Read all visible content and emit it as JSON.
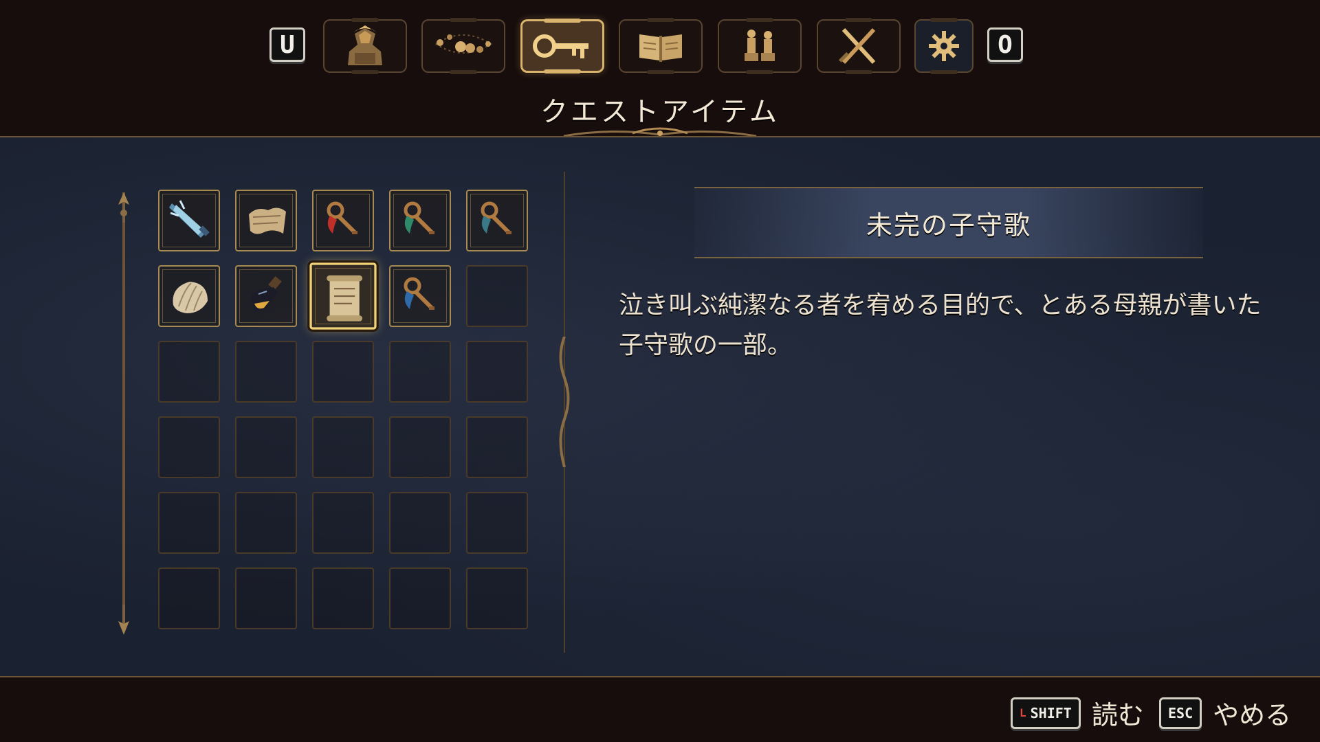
{
  "header": {
    "prev_key": "U",
    "next_key": "O",
    "tabs": [
      {
        "id": "character",
        "icon": "character-bust-icon"
      },
      {
        "id": "rosary",
        "icon": "rosary-beads-icon"
      },
      {
        "id": "quest-items",
        "icon": "key-icon",
        "active": true
      },
      {
        "id": "lore",
        "icon": "open-book-icon"
      },
      {
        "id": "figures",
        "icon": "figurines-icon"
      },
      {
        "id": "weapons",
        "icon": "crossed-swords-icon"
      },
      {
        "id": "settings",
        "icon": "gear-icon"
      }
    ],
    "section_title": "クエストアイテム"
  },
  "inventory": {
    "columns": 5,
    "rows": 6,
    "items": [
      {
        "icon": "blue-crystal-dagger-icon"
      },
      {
        "icon": "parchment-fragment-icon"
      },
      {
        "icon": "red-ribbon-key-icon"
      },
      {
        "icon": "green-ribbon-key-icon"
      },
      {
        "icon": "teal-ribbon-key-icon"
      },
      {
        "icon": "seashell-icon"
      },
      {
        "icon": "potion-bottle-icon"
      },
      {
        "icon": "scroll-icon",
        "selected": true
      },
      {
        "icon": "blue-ribbon-key-icon"
      }
    ]
  },
  "detail": {
    "item_name": "未完の子守歌",
    "description": "泣き叫ぶ純潔なる者を宥める目的で、とある母親が書いた子守歌の一部。"
  },
  "footer": {
    "read_key": "SHIFT",
    "read_key_prefix": "L",
    "read_label": "読む",
    "exit_key": "ESC",
    "exit_label": "やめる"
  },
  "colors": {
    "gold": "#d9b46e",
    "panel_bg": "#1a2130",
    "frame_bg": "#170d0c"
  }
}
